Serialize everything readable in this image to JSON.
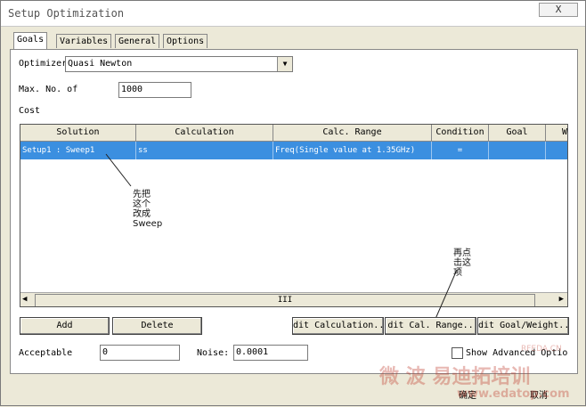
{
  "window": {
    "title": "Setup Optimization",
    "close_label": "X"
  },
  "tabs": [
    {
      "label": "Goals",
      "active": true
    },
    {
      "label": "Variables",
      "active": false
    },
    {
      "label": "General",
      "active": false
    },
    {
      "label": "Options",
      "active": false
    }
  ],
  "optimizer": {
    "label": "Optimizer",
    "value": "Quasi Newton"
  },
  "max_iter": {
    "label": "Max. No. of",
    "value": "1000"
  },
  "cost_label": "Cost",
  "table": {
    "columns": [
      "Solution",
      "Calculation",
      "Calc. Range",
      "Condition",
      "Goal",
      "We"
    ],
    "rows": [
      {
        "solution": "Setup1 : Sweep1",
        "calculation": "ss",
        "calc_range": "Freq(Single value at 1.35GHz)",
        "condition": "=",
        "goal": "",
        "weight": ""
      }
    ],
    "scroll_label": "III"
  },
  "buttons": {
    "add": "Add",
    "delete": "Delete",
    "edit_calculation": "dit Calculation..",
    "edit_calc_range": "dit Cal. Range..",
    "edit_goal_weight": "dit Goal/Weight.."
  },
  "acceptable": {
    "label": "Acceptable",
    "value": "0"
  },
  "noise": {
    "label": "Noise:",
    "value": "0.0001"
  },
  "show_advanced": {
    "label": "Show Advanced Optio"
  },
  "footer": {
    "ok_label": "确定",
    "cancel_label": "取消"
  },
  "annotations": {
    "first": "先把\n这个\n改成\nSweep",
    "second": "再点\n击这\n项"
  },
  "watermarks": {
    "main": "微 波   易迪拓培训",
    "url": "www.edatop.com",
    "small": "RFEDA.CN"
  },
  "colors": {
    "selection": "#3b8fe0",
    "window_bg": "#ece9d8",
    "watermark": "#c0392b"
  }
}
